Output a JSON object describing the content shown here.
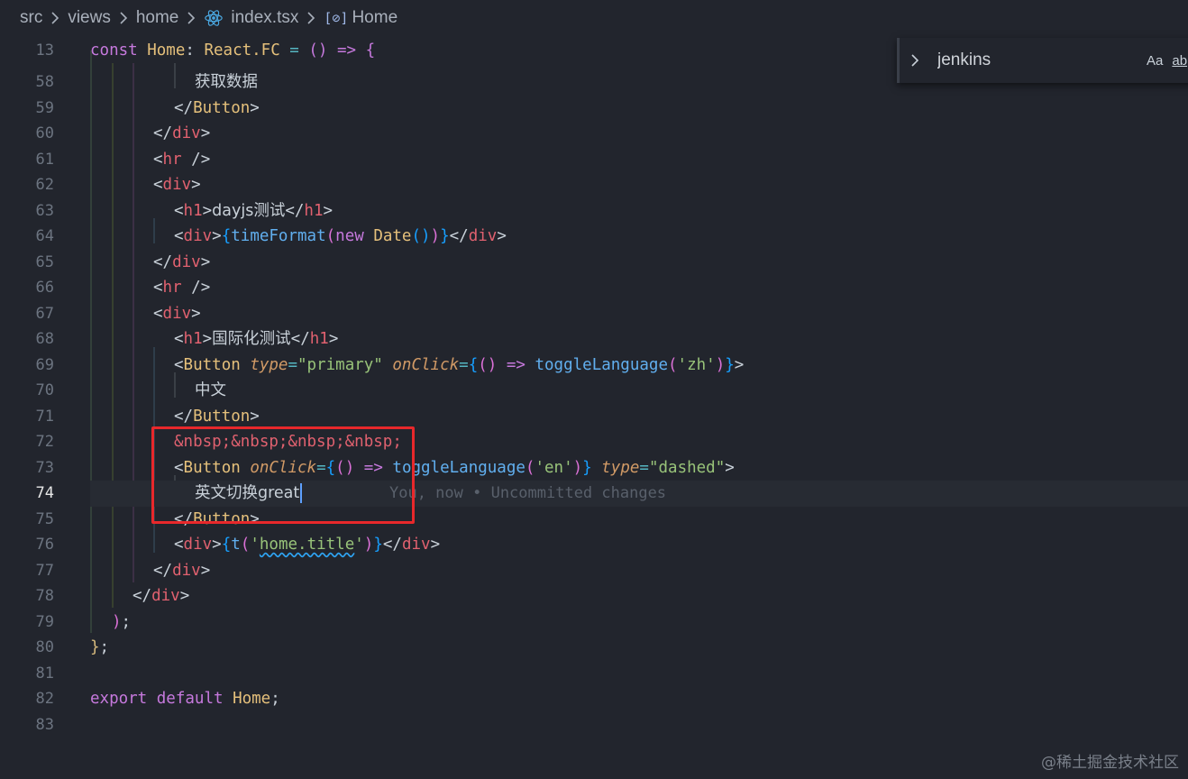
{
  "breadcrumb": {
    "items": [
      "src",
      "views",
      "home",
      "index.tsx",
      "Home"
    ],
    "symbol_glyph": "[⊘]"
  },
  "find_widget": {
    "value": "jenkins",
    "match_case": "Aa",
    "whole_word": "ab"
  },
  "editor": {
    "active_line": "74",
    "git_blame": "You, now • Uncommitted changes",
    "lines": [
      {
        "n": "13"
      },
      {
        "n": "58"
      },
      {
        "n": "59"
      },
      {
        "n": "60"
      },
      {
        "n": "61"
      },
      {
        "n": "62"
      },
      {
        "n": "63"
      },
      {
        "n": "64"
      },
      {
        "n": "65"
      },
      {
        "n": "66"
      },
      {
        "n": "67"
      },
      {
        "n": "68"
      },
      {
        "n": "69"
      },
      {
        "n": "70"
      },
      {
        "n": "71"
      },
      {
        "n": "72"
      },
      {
        "n": "73"
      },
      {
        "n": "74"
      },
      {
        "n": "75"
      },
      {
        "n": "76"
      },
      {
        "n": "77"
      },
      {
        "n": "78"
      },
      {
        "n": "79"
      },
      {
        "n": "80"
      },
      {
        "n": "81"
      },
      {
        "n": "82"
      },
      {
        "n": "83"
      }
    ],
    "text": {
      "t_const": "const",
      "t_home": "Home",
      "t_react_fc": "React.FC",
      "t_arrow_fn": "() => {",
      "t_fetch": "获取数据",
      "t_button": "Button",
      "t_div": "div",
      "t_hr": "hr",
      "t_h1": "h1",
      "t_dayjs": "dayjs测试",
      "t_timeformat": "timeFormat",
      "t_new": "new",
      "t_date": "Date",
      "t_i18n": "国际化测试",
      "t_type": "type",
      "t_primary": "\"primary\"",
      "t_onclick": "onClick",
      "t_toggle": "toggleLanguage",
      "t_zh": "'zh'",
      "t_chinese": "中文",
      "t_nbsp": "&nbsp;&nbsp;&nbsp;&nbsp;",
      "t_en": "'en'",
      "t_dashed": "\"dashed\"",
      "t_en_switch": "英文切换great",
      "t_t": "t",
      "t_home_title": "home.title",
      "t_export": "export",
      "t_default": "default"
    }
  },
  "watermark": "@稀土掘金技术社区",
  "colors": {
    "background": "#22252d",
    "highlight_box": "#e8282b",
    "keyword": "#c679dd",
    "tag": "#e0616f",
    "component": "#e5c07b",
    "string": "#98c379",
    "function": "#61afef"
  }
}
